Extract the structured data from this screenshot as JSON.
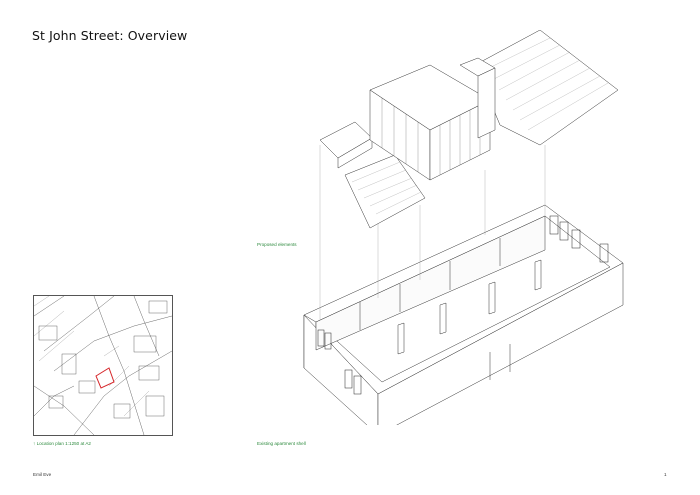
{
  "title": "St John Street: Overview",
  "captions": {
    "proposed": "Proposed elements",
    "location_plan": "↑ Location plan 1:1250 at A2",
    "existing": "Existing apartment shell"
  },
  "footer": {
    "author": "Emil Eve",
    "page_number": "1"
  },
  "colors": {
    "caption": "#2d8a3e",
    "site_outline": "#d6262a",
    "linework": "#333333"
  }
}
